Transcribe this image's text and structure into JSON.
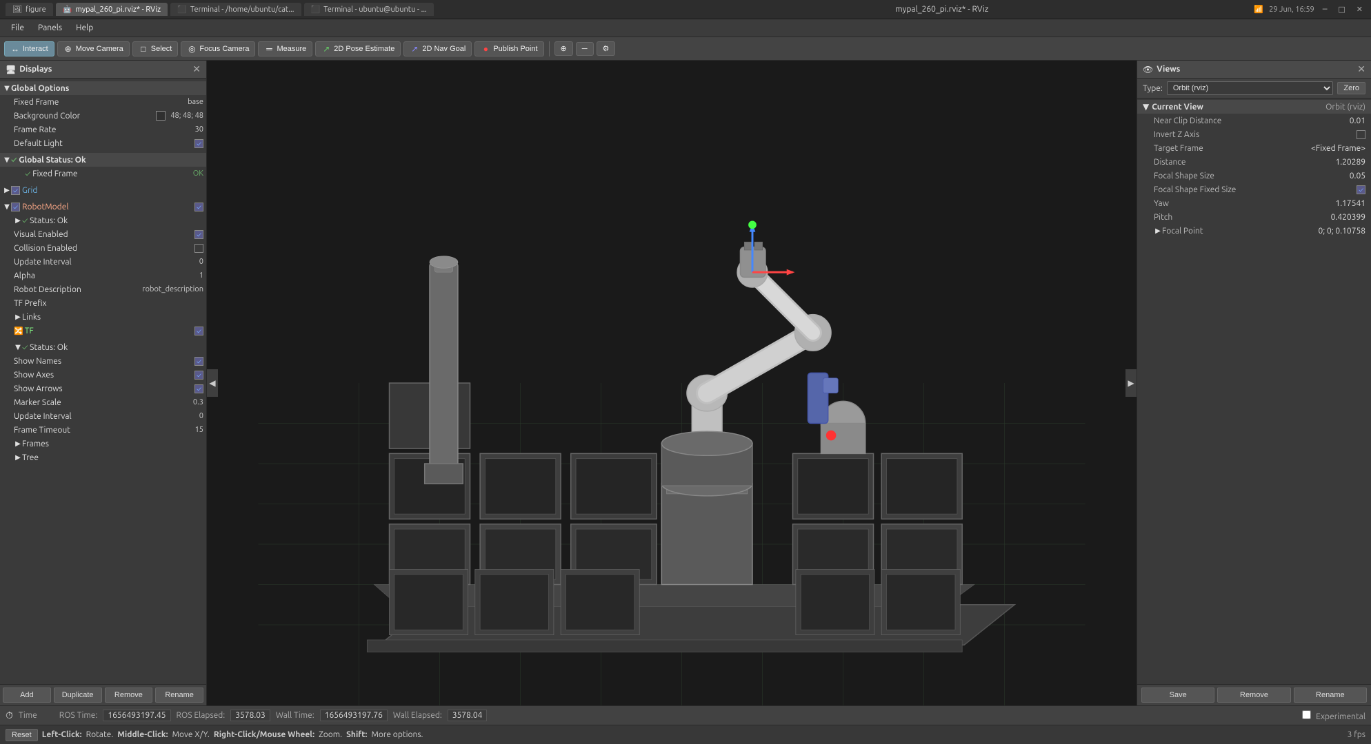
{
  "titlebar": {
    "tabs": [
      {
        "label": "figure",
        "active": false
      },
      {
        "label": "mypal_260_pi.rviz* - RViz",
        "active": true
      },
      {
        "label": "Terminal - /home/ubuntu/cat...",
        "active": false
      },
      {
        "label": "Terminal - ubuntu@ubuntu - ...",
        "active": false
      }
    ],
    "title": "mypal_260_pi.rviz* - RViz",
    "time": "29 Jun, 16:59",
    "close": "✕",
    "minimize": "─",
    "maximize": "□"
  },
  "menubar": {
    "items": [
      "File",
      "Panels",
      "Help"
    ]
  },
  "toolbar": {
    "buttons": [
      {
        "label": "Interact",
        "icon": "↔",
        "active": true
      },
      {
        "label": "Move Camera",
        "icon": "⊕",
        "active": false
      },
      {
        "label": "Select",
        "icon": "□",
        "active": false
      },
      {
        "label": "Focus Camera",
        "icon": "◎",
        "active": false
      },
      {
        "label": "Measure",
        "icon": "═",
        "active": false
      },
      {
        "label": "2D Pose Estimate",
        "icon": "↗",
        "active": false
      },
      {
        "label": "2D Nav Goal",
        "icon": "↗",
        "active": false
      },
      {
        "label": "Publish Point",
        "icon": "●",
        "active": false
      }
    ],
    "right_icons": [
      "⊕",
      "─",
      "⚙"
    ]
  },
  "displays": {
    "panel_title": "Displays",
    "sections": [
      {
        "name": "Global Options",
        "expanded": true,
        "icon": "▼",
        "items": [
          {
            "label": "Fixed Frame",
            "value": "base",
            "type": "text"
          },
          {
            "label": "Background Color",
            "value": "48; 48; 48",
            "type": "color",
            "color": "#303030"
          },
          {
            "label": "Frame Rate",
            "value": "30",
            "type": "text"
          },
          {
            "label": "Default Light",
            "value": "",
            "type": "checkbox",
            "checked": true
          }
        ]
      },
      {
        "name": "Global Status: Ok",
        "expanded": true,
        "icon": "▼",
        "status": "ok",
        "items": [
          {
            "label": "Fixed Frame",
            "value": "OK",
            "type": "status_ok"
          }
        ]
      },
      {
        "name": "Grid",
        "expanded": false,
        "icon": "▶",
        "type": "grid",
        "enabled": true
      },
      {
        "name": "RobotModel",
        "expanded": true,
        "icon": "▼",
        "type": "robot",
        "enabled": true,
        "items": [
          {
            "label": "Status: Ok",
            "value": "",
            "type": "status_ok"
          },
          {
            "label": "Visual Enabled",
            "value": "",
            "type": "checkbox",
            "checked": true
          },
          {
            "label": "Collision Enabled",
            "value": "",
            "type": "checkbox",
            "checked": false
          },
          {
            "label": "Update Interval",
            "value": "0",
            "type": "text"
          },
          {
            "label": "Alpha",
            "value": "1",
            "type": "text"
          },
          {
            "label": "Robot Description",
            "value": "robot_description",
            "type": "text"
          },
          {
            "label": "TF Prefix",
            "value": "",
            "type": "text"
          },
          {
            "label": "Links",
            "value": "",
            "type": "expandable"
          },
          {
            "label": "TF",
            "value": "",
            "type": "expandable"
          }
        ]
      },
      {
        "name": "TF",
        "expanded": true,
        "icon": "▼",
        "type": "tf",
        "enabled": true,
        "items": [
          {
            "label": "Status: Ok",
            "value": "",
            "type": "status_ok"
          },
          {
            "label": "Show Names",
            "value": "",
            "type": "checkbox",
            "checked": true
          },
          {
            "label": "Show Axes",
            "value": "",
            "type": "checkbox",
            "checked": true
          },
          {
            "label": "Show Arrows",
            "value": "",
            "type": "checkbox",
            "checked": true
          },
          {
            "label": "Marker Scale",
            "value": "0.3",
            "type": "text"
          },
          {
            "label": "Update Interval",
            "value": "0",
            "type": "text"
          },
          {
            "label": "Frame Timeout",
            "value": "15",
            "type": "text"
          },
          {
            "label": "Frames",
            "value": "",
            "type": "expandable"
          },
          {
            "label": "Tree",
            "value": "",
            "type": "expandable"
          }
        ]
      }
    ],
    "buttons": [
      "Add",
      "Duplicate",
      "Remove",
      "Rename"
    ]
  },
  "views": {
    "panel_title": "Views",
    "type_label": "Type:",
    "type_value": "Orbit (rviz)",
    "zero_label": "Zero",
    "current_view": {
      "section_label": "Current View",
      "section_value": "Orbit (rviz)",
      "properties": [
        {
          "label": "Near Clip Distance",
          "value": "0.01"
        },
        {
          "label": "Invert Z Axis",
          "value": ""
        },
        {
          "label": "Target Frame",
          "value": "<Fixed Frame>"
        },
        {
          "label": "Distance",
          "value": "1.20289"
        },
        {
          "label": "Focal Shape Size",
          "value": "0.05"
        },
        {
          "label": "Focal Shape Fixed Size",
          "value": "✓"
        },
        {
          "label": "Yaw",
          "value": "1.17541"
        },
        {
          "label": "Pitch",
          "value": "0.420399"
        },
        {
          "label": "Focal Point",
          "value": "0; 0; 0.10758"
        }
      ]
    },
    "buttons": [
      "Save",
      "Remove",
      "Rename"
    ]
  },
  "time_bar": {
    "title": "Time",
    "ros_time_label": "ROS Time:",
    "ros_time_value": "1656493197.45",
    "ros_elapsed_label": "ROS Elapsed:",
    "ros_elapsed_value": "3578.03",
    "wall_time_label": "Wall Time:",
    "wall_time_value": "1656493197.76",
    "wall_elapsed_label": "Wall Elapsed:",
    "wall_elapsed_value": "3578.04",
    "experimental_label": "Experimental"
  },
  "status_bar": {
    "reset_label": "Reset",
    "left_click": "Left-Click:",
    "left_click_action": "Rotate.",
    "middle_click": "Middle-Click:",
    "middle_click_action": "Move X/Y.",
    "right_click": "Right-Click/Mouse Wheel:",
    "right_click_action": "Zoom.",
    "shift": "Shift:",
    "shift_action": "More options.",
    "fps": "3 fps"
  }
}
